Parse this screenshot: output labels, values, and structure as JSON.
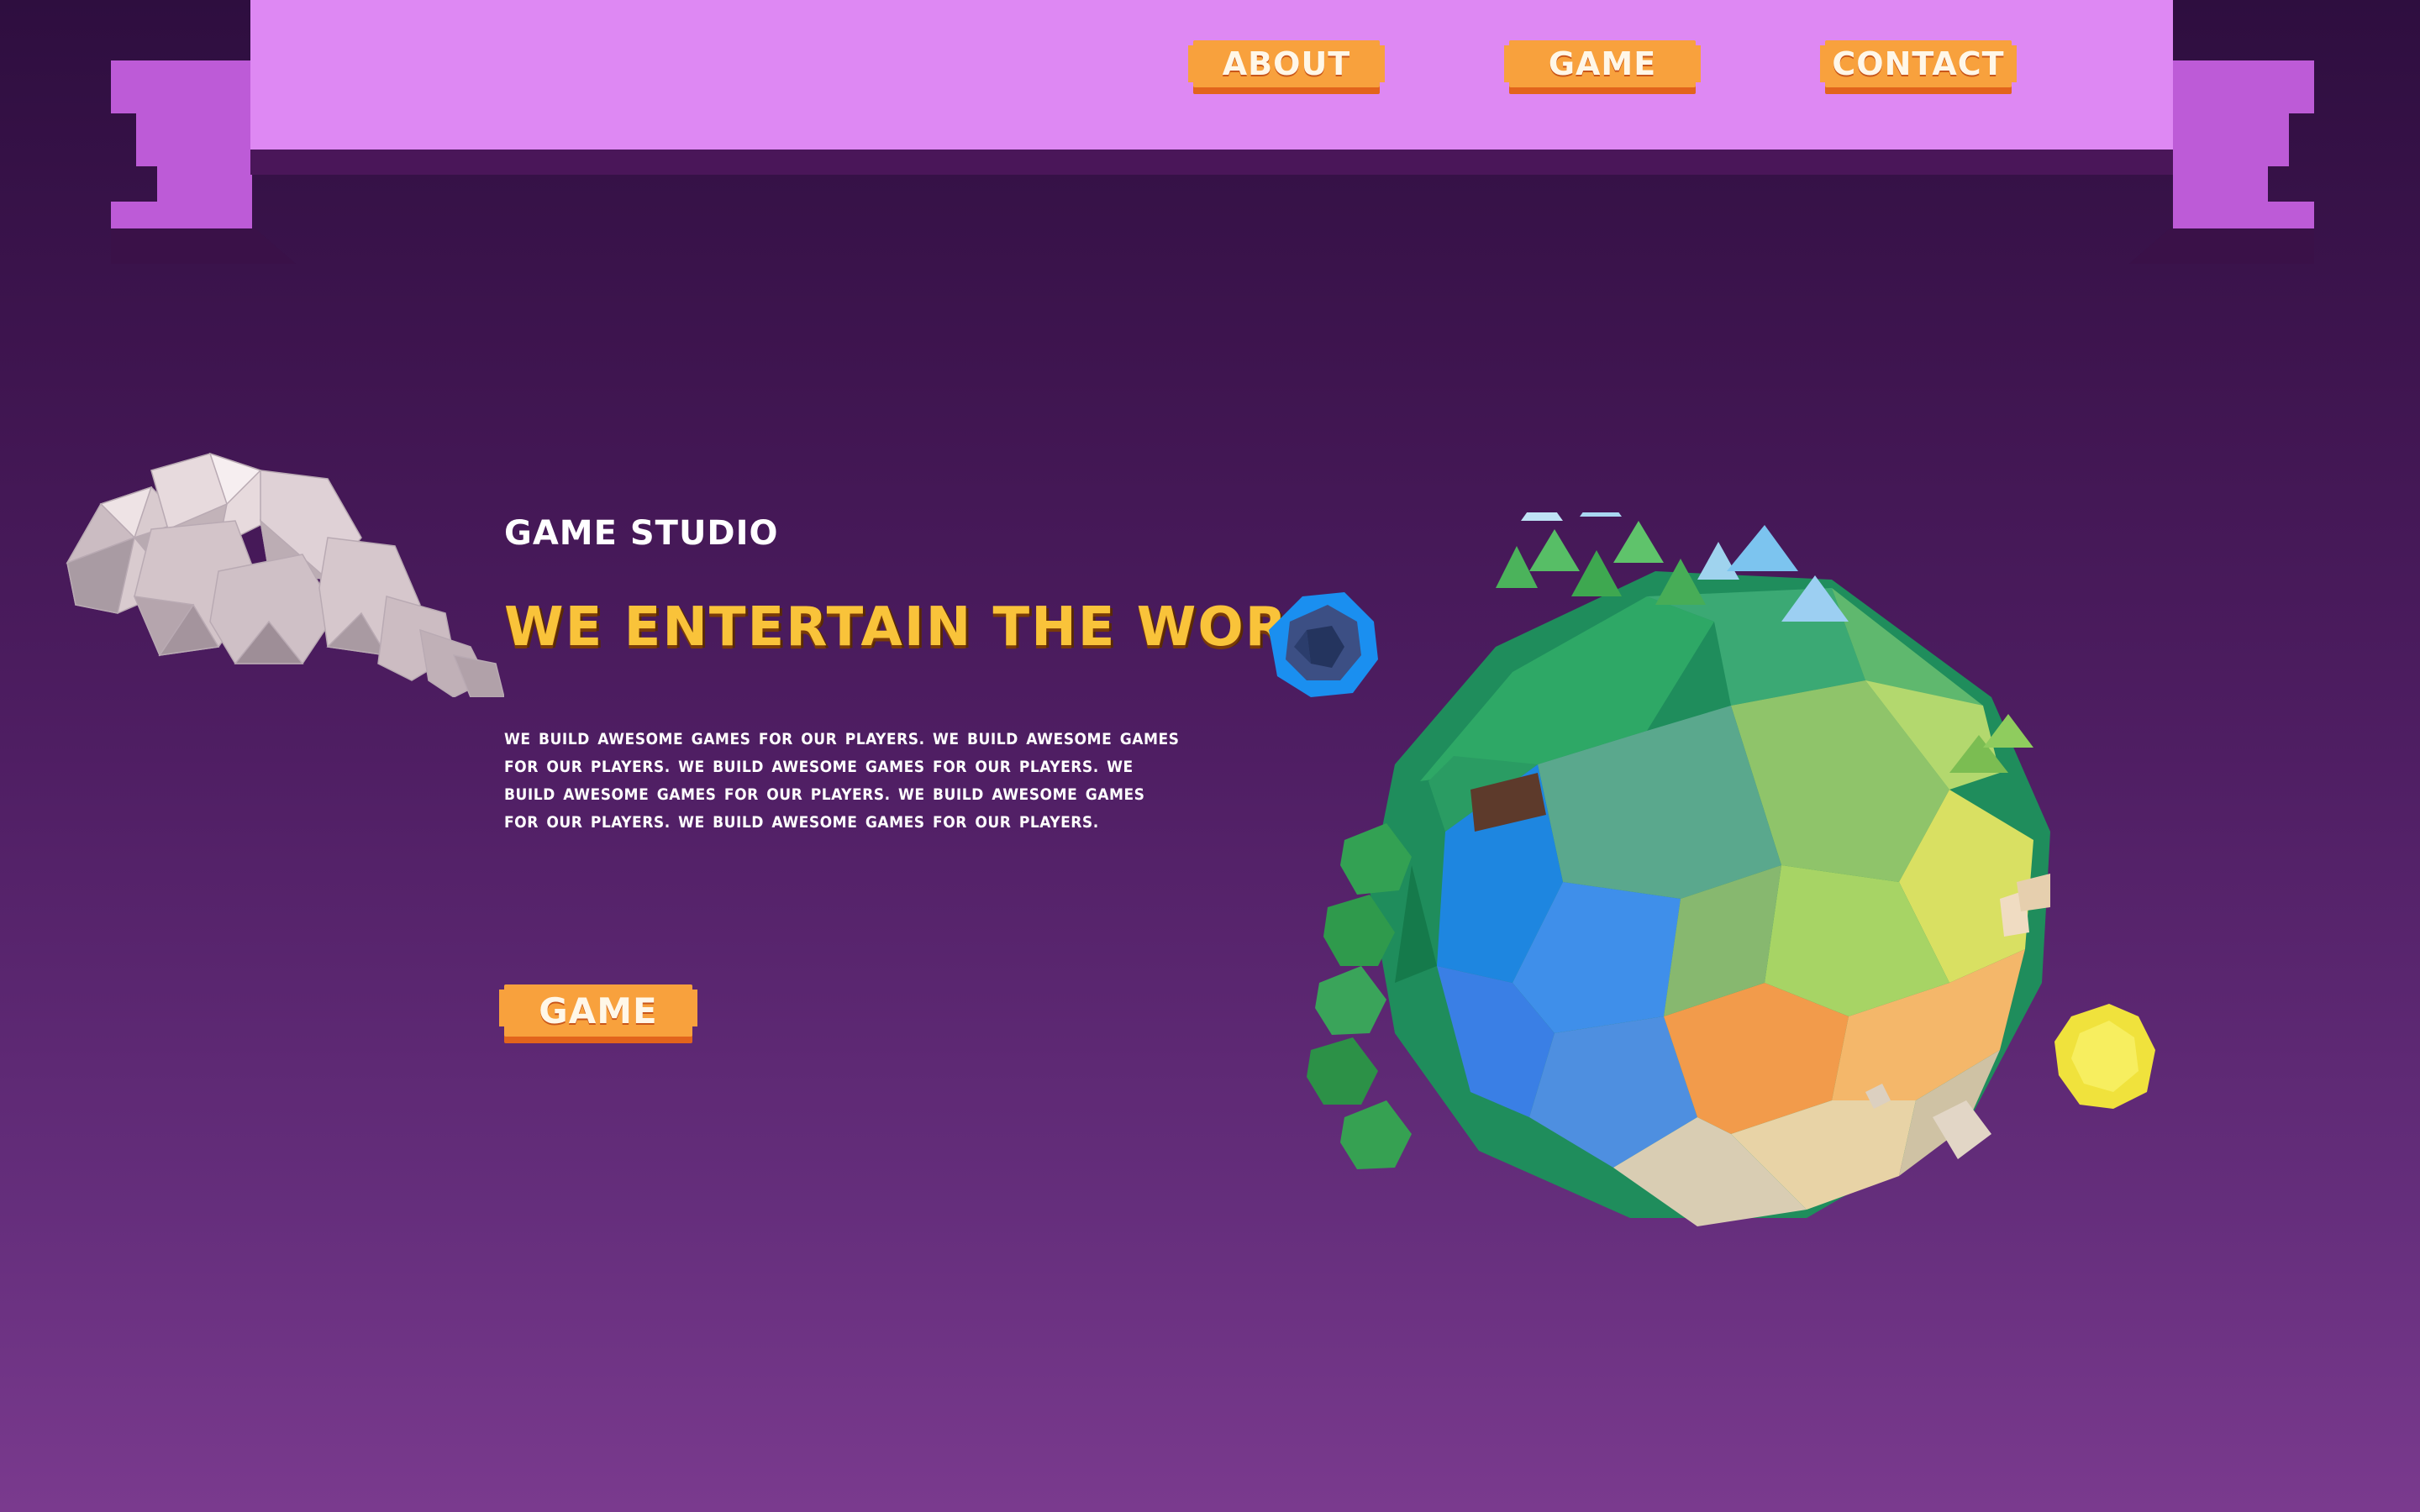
{
  "nav": {
    "items": [
      {
        "label": "ABOUT"
      },
      {
        "label": "GAME"
      },
      {
        "label": "CONTACT"
      }
    ]
  },
  "hero": {
    "eyebrow": "GAME STUDIO",
    "headline": "WE ENTERTAIN THE WORLD",
    "body": "WE BUILD AWESOME GAMES FOR OUR PLAYERS.  WE BUILD AWESOME GAMES FOR OUR PLAYERS. WE BUILD AWESOME GAMES FOR OUR PLAYERS. WE BUILD AWESOME GAMES FOR OUR PLAYERS. WE BUILD AWESOME GAMES FOR OUR PLAYERS. WE BUILD AWESOME GAMES FOR OUR PLAYERS.",
    "cta_label": "GAME"
  },
  "colors": {
    "banner": "#de88f3",
    "ribbon": "#bd5bd7",
    "button": "#f8a13d",
    "button_shadow": "#e2641c",
    "headline": "#f9c33a",
    "background_top": "#2e0e3f",
    "background_bottom": "#7a3a8e"
  },
  "icons": {
    "cloud": "lowpoly-cloud-illustration",
    "planet": "lowpoly-planet-illustration",
    "moon": "blue-moon-illustration",
    "sun": "yellow-sun-illustration"
  }
}
